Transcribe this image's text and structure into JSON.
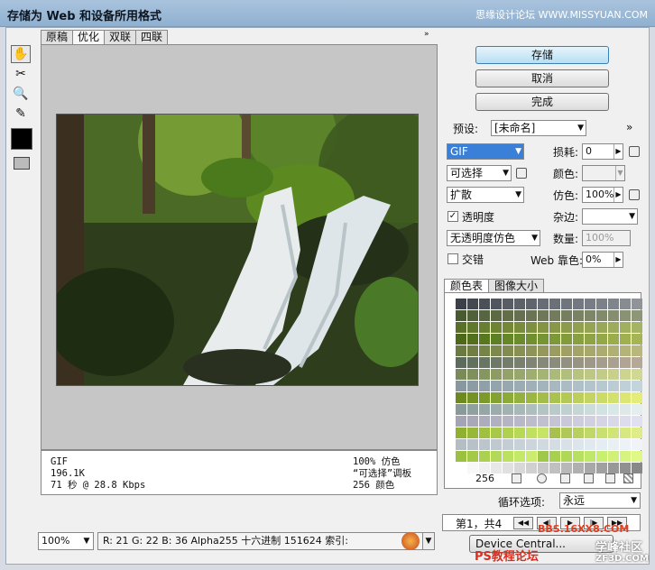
{
  "window": {
    "title": "存储为 Web 和设备所用格式",
    "watermark_top": "思缘设计论坛  WWW.MISSYUAN.COM"
  },
  "tabs": [
    "原稿",
    "优化",
    "双联",
    "四联"
  ],
  "active_tab": "优化",
  "buttons": {
    "save": "存储",
    "cancel": "取消",
    "done": "完成"
  },
  "settings": {
    "preset_label": "预设:",
    "preset_value": "[未命名]",
    "format": "GIF",
    "lossy_label": "损耗:",
    "lossy_value": "0",
    "palette": "可选择",
    "colors_label": "颜色:",
    "colors_value": "",
    "dither_algo": "扩散",
    "dither_label": "仿色:",
    "dither_value": "100%",
    "transparency_label": "透明度",
    "transparency_checked": true,
    "matte_label": "杂边:",
    "trans_dither": "无透明度仿色",
    "amount_label": "数量:",
    "amount_value": "100%",
    "interlaced_label": "交错",
    "interlaced_checked": false,
    "websnap_label": "Web 靠色:",
    "websnap_value": "0%"
  },
  "info": {
    "left": [
      "GIF",
      "196.1K",
      "71 秒 @ 28.8 Kbps"
    ],
    "right": [
      "100% 仿色",
      "“可选择”调板",
      "256 颜色"
    ]
  },
  "status": {
    "zoom": "100%",
    "readout": "R:  21  G:  22  B:  36  Alpha255  十六进制  151624  索引:"
  },
  "panel": {
    "tabs": [
      "颜色表",
      "图像大小"
    ],
    "color_count": "256",
    "colors": [
      "#3c4048",
      "#444850",
      "#4a5058",
      "#505660",
      "#585c64",
      "#5c6268",
      "#60646c",
      "#686c74",
      "#6c7078",
      "#70747c",
      "#747880",
      "#787c84",
      "#7c8088",
      "#80848c",
      "#888c90",
      "#909498",
      "#4a5a30",
      "#506038",
      "#566640",
      "#5c6a44",
      "#626e48",
      "#667050",
      "#6a7454",
      "#6e7858",
      "#727c5c",
      "#767e60",
      "#7a8264",
      "#7e8668",
      "#828a6c",
      "#868e70",
      "#8a9274",
      "#8e9678",
      "#5a7028",
      "#60782c",
      "#687e30",
      "#6e8434",
      "#748838",
      "#788c3c",
      "#7e9040",
      "#849444",
      "#889848",
      "#8c9c4c",
      "#90a050",
      "#94a454",
      "#98a858",
      "#9cac5c",
      "#a0b060",
      "#a4b464",
      "#4c6818",
      "#52701c",
      "#587820",
      "#5e8024",
      "#648828",
      "#6a8c2c",
      "#709030",
      "#769434",
      "#7c9838",
      "#829c3c",
      "#88a040",
      "#8ea444",
      "#94a848",
      "#9aac4c",
      "#a0b050",
      "#a6b454",
      "#6a7a40",
      "#707e44",
      "#768448",
      "#7c884c",
      "#828c50",
      "#889054",
      "#8e9458",
      "#94985c",
      "#9a9c60",
      "#a0a064",
      "#a4a468",
      "#a8a86c",
      "#acac70",
      "#b0b074",
      "#b4b478",
      "#b8b87c",
      "#5c6c5c",
      "#627060",
      "#687464",
      "#6e7868",
      "#747c6c",
      "#7a8070",
      "#808474",
      "#868878",
      "#8c8c7c",
      "#929080",
      "#989484",
      "#9e9888",
      "#a49c8c",
      "#aaa090",
      "#b0a494",
      "#b6a898",
      "#7a8a58",
      "#80905c",
      "#869660",
      "#8c9c64",
      "#92a268",
      "#98a86c",
      "#9eae70",
      "#a4b474",
      "#aaba78",
      "#b0c07c",
      "#b6c480",
      "#bcc884",
      "#c2cc88",
      "#c8d08c",
      "#ccd490",
      "#d0d894",
      "#8898a0",
      "#8c9ca4",
      "#90a0a8",
      "#94a4ac",
      "#98a8b0",
      "#9cacb4",
      "#a0b0b8",
      "#a4b4bc",
      "#a8b8c0",
      "#acbcc4",
      "#b0c0c8",
      "#b4c4cc",
      "#b8c8d0",
      "#bcccd4",
      "#c0d0d8",
      "#c4d4dc",
      "#6c8a20",
      "#749226",
      "#7c9a2c",
      "#84a232",
      "#8caa38",
      "#94b03e",
      "#9cb644",
      "#a4bc4a",
      "#acc250",
      "#b4c856",
      "#bcce5c",
      "#c4d462",
      "#ccda68",
      "#d4e06e",
      "#dce674",
      "#e4ec7a",
      "#8a9a9a",
      "#90a0a0",
      "#96a6a6",
      "#9cacac",
      "#a2b2b2",
      "#a8b8b8",
      "#aebebe",
      "#b4c4c4",
      "#bacaca",
      "#c0d0d0",
      "#c6d6d6",
      "#ccdcdc",
      "#d2e2e2",
      "#d8e8e8",
      "#dee8e8",
      "#e4eeee",
      "#a4a4b4",
      "#a8a8b8",
      "#acacbc",
      "#b0b0c0",
      "#b4b4c4",
      "#b8b8c8",
      "#bcbccc",
      "#c0c0d0",
      "#c4c4d4",
      "#c8c8d8",
      "#ccccdc",
      "#d0d0e0",
      "#d4d4e4",
      "#d8d8e8",
      "#dcdcec",
      "#e0e0f0",
      "#90b030",
      "#98b838",
      "#a0c040",
      "#a8c848",
      "#b0d050",
      "#b8d858",
      "#c0e060",
      "#c8e468",
      "#a8c050",
      "#b0c858",
      "#b8d060",
      "#c0d868",
      "#c8e070",
      "#d0e478",
      "#d8e880",
      "#e0ec88",
      "#b4bcc4",
      "#b8c0c8",
      "#bcc4cc",
      "#c0c8d0",
      "#c4ccd4",
      "#c8d0d8",
      "#ccd4dc",
      "#d0d8e0",
      "#d4dce4",
      "#d8e0e8",
      "#dce4ec",
      "#e0e8f0",
      "#e4ecf4",
      "#e8f0f4",
      "#ecf2f6",
      "#f0f4f8",
      "#9cc040",
      "#a4c848",
      "#acd050",
      "#b4d858",
      "#bce060",
      "#c4e868",
      "#ccec70",
      "#a0c848",
      "#a8d050",
      "#b0d858",
      "#b8e060",
      "#c0e868",
      "#c8f070",
      "#d0f078",
      "#d8f480",
      "#e0f888",
      "#ffffff",
      "#f8f8f8",
      "#f0f0f0",
      "#e8e8e8",
      "#e0e0e0",
      "#d8d8d8",
      "#d0d0d0",
      "#c8c8c8",
      "#c0c0c0",
      "#b8b8b8",
      "#b0b0b0",
      "#a8a8a8",
      "#a0a0a0",
      "#989898",
      "#909090",
      "#888888"
    ]
  },
  "loop_label": "循环选项:",
  "loop_value": "永远",
  "frames": "第1，共4",
  "device_button": "Device Central...",
  "watermarks": {
    "ps": "PS教程论坛",
    "site": "学峰社区",
    "url": "BBS.16XX8.COM",
    "domain": "ZF3D.COM"
  }
}
